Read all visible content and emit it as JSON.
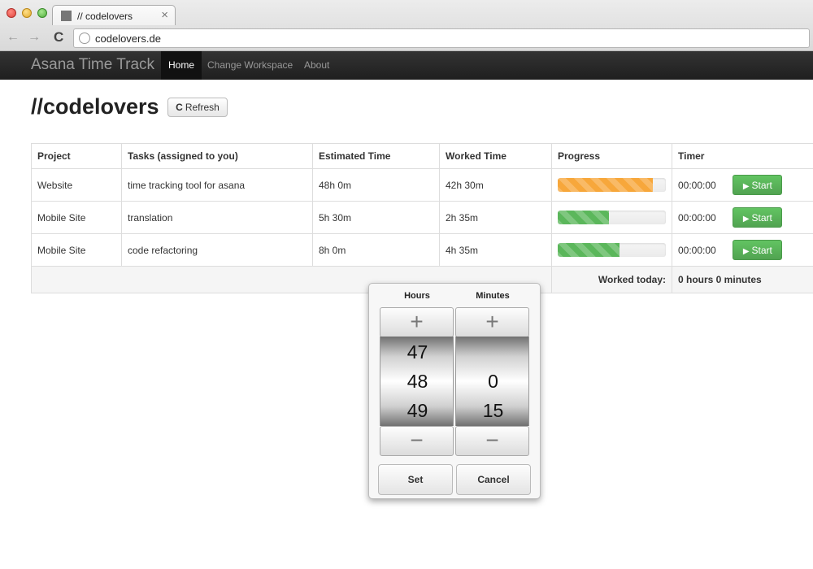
{
  "browser": {
    "tab_title": "// codelovers",
    "tab_close": "×",
    "url": "codelovers.de",
    "back": "←",
    "forward": "→",
    "reload": "C"
  },
  "navbar": {
    "brand": "Asana Time Track",
    "items": [
      {
        "label": "Home",
        "active": true
      },
      {
        "label": "Change Workspace",
        "active": false
      },
      {
        "label": "About",
        "active": false
      }
    ]
  },
  "page": {
    "title": "//codelovers",
    "refresh_icon": "C",
    "refresh_label": "Refresh"
  },
  "table": {
    "headers": [
      "Project",
      "Tasks (assigned to you)",
      "Estimated Time",
      "Worked Time",
      "Progress",
      "Timer"
    ],
    "rows": [
      {
        "project": "Website",
        "task": "time tracking tool for asana",
        "estimated": "48h 0m",
        "worked": "42h 30m",
        "progress": 0.88,
        "status": "warning",
        "timer": "00:00:00",
        "action": "Start"
      },
      {
        "project": "Mobile Site",
        "task": "translation",
        "estimated": "5h 30m",
        "worked": "2h 35m",
        "progress": 0.47,
        "status": "ok",
        "timer": "00:00:00",
        "action": "Start"
      },
      {
        "project": "Mobile Site",
        "task": "code refactoring",
        "estimated": "8h 0m",
        "worked": "4h 35m",
        "progress": 0.57,
        "status": "ok",
        "timer": "00:00:00",
        "action": "Start"
      }
    ],
    "footer": {
      "label": "Worked today:",
      "value": "0 hours 0 minutes"
    }
  },
  "picker": {
    "hours_label": "Hours",
    "minutes_label": "Minutes",
    "increment_icon": "+",
    "decrement_icon": "−",
    "hours_values": [
      "47",
      "48",
      "49"
    ],
    "minutes_values": [
      "",
      "0",
      "15"
    ],
    "set_label": "Set",
    "cancel_label": "Cancel"
  },
  "colors": {
    "progress_warning": "#f7a73b",
    "progress_ok": "#5bb75b",
    "start_button": "#5bb75b",
    "navbar_bg": "#222222"
  },
  "icons": {
    "favicon": "page-icon",
    "globe": "globe-icon",
    "refresh": "refresh-icon",
    "play": "play-icon"
  }
}
